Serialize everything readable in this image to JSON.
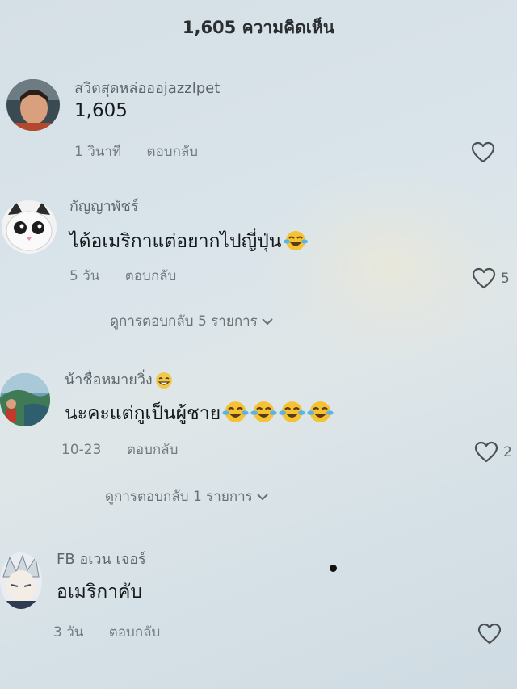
{
  "header": {
    "title": "1,605 ความคิดเห็น"
  },
  "comments": [
    {
      "username": "สวิตสุดหล่อออjazzlpet",
      "text": "1,605",
      "time": "1 วินาที",
      "reply_label": "ตอบกลับ",
      "likes": ""
    },
    {
      "username": "กัญญาพัชร์",
      "text": "ได้อเมริกาแต่อยากไปญี่ปุ่น",
      "time": "5 วัน",
      "reply_label": "ตอบกลับ",
      "likes": "5",
      "view_replies": "ดูการตอบกลับ 5 รายการ"
    },
    {
      "username": "น้าชื่อหมายวิ่ง",
      "text": "นะคะแต่กูเป็นผู้ชาย",
      "time": "10-23",
      "reply_label": "ตอบกลับ",
      "likes": "2",
      "view_replies": "ดูการตอบกลับ 1 รายการ"
    },
    {
      "username": "FB อเวน เจอร์",
      "text": "อเมริกาคับ",
      "time": "3 วัน",
      "reply_label": "ตอบกลับ",
      "likes": ""
    }
  ],
  "icons": {
    "like": "heart-outline-icon",
    "expand": "chevron-down-icon",
    "emoji_laugh": "face-with-tears-of-joy-icon",
    "emoji_grin": "grinning-face-icon"
  }
}
